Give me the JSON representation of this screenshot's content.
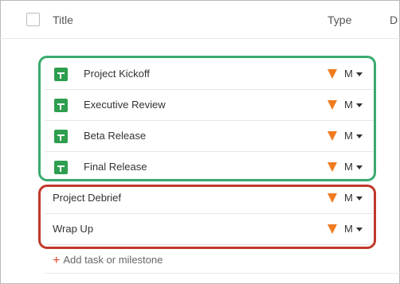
{
  "header": {
    "title_col": "Title",
    "type_col": "Type",
    "next_col": "D"
  },
  "milestones": [
    {
      "label": "Project Kickoff",
      "type": "M"
    },
    {
      "label": "Executive Review",
      "type": "M"
    },
    {
      "label": "Beta Release",
      "type": "M"
    },
    {
      "label": "Final Release",
      "type": "M"
    }
  ],
  "tasks": [
    {
      "label": "Project Debrief",
      "type": "M"
    },
    {
      "label": "Wrap Up",
      "type": "M"
    }
  ],
  "add": {
    "plus": "+",
    "label": "Add task or milestone"
  },
  "colors": {
    "milestone_icon": "#2e9e4f",
    "flag": "#f07b1f",
    "green_box": "#3aaa6e",
    "red_box": "#c0392b",
    "add_plus": "#d84a2f"
  },
  "icons": {
    "milestone": "milestone-grid-icon",
    "type": "orange-flag-icon",
    "dropdown": "chevron-down-icon"
  }
}
